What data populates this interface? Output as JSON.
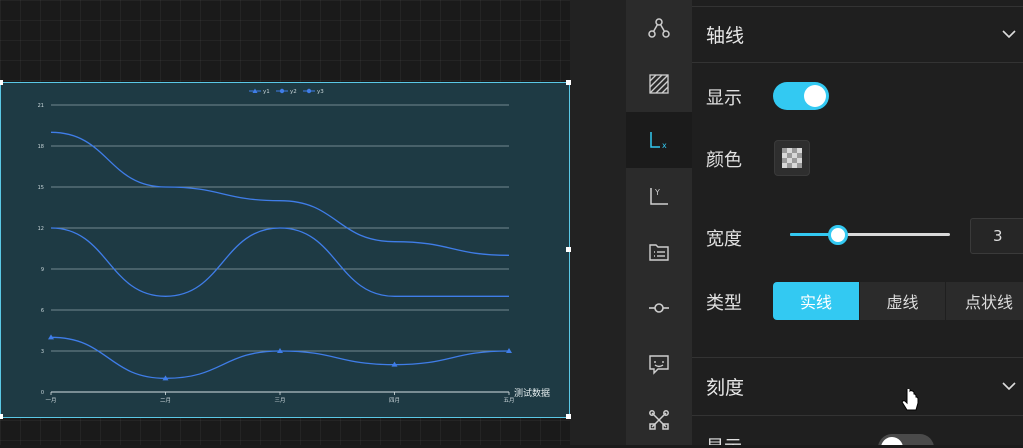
{
  "chart_data": {
    "type": "line",
    "categories": [
      "一月",
      "二月",
      "三月",
      "四月",
      "五月"
    ],
    "xlabel": "测试数据",
    "ylim": [
      0,
      21
    ],
    "yticks": [
      0,
      3,
      6,
      9,
      12,
      15,
      18,
      21
    ],
    "grid": true,
    "legend_position": "top-center",
    "series": [
      {
        "name": "y1",
        "values": [
          4,
          1,
          3,
          2,
          3
        ],
        "marker": "triangle"
      },
      {
        "name": "y2",
        "values": [
          12,
          7,
          12,
          7,
          7
        ],
        "marker": "circle"
      },
      {
        "name": "y3",
        "values": [
          19,
          15,
          14,
          11,
          10
        ],
        "marker": "circle"
      }
    ],
    "colors": {
      "line": "#3f7de8",
      "background": "#1e3a44",
      "grid": "#8fa3a8"
    }
  },
  "sidebar_icons": [
    "node-graph-icon",
    "hatched-area-icon",
    "x-axis-icon",
    "y-axis-icon",
    "legend-list-icon",
    "line-node-icon",
    "tooltip-icon",
    "tools-icon"
  ],
  "panel": {
    "axis_section": {
      "title": "轴线"
    },
    "show_label": "显示",
    "show_enabled": true,
    "color_label": "颜色",
    "width_label": "宽度",
    "width_value": "3",
    "width_slider_fraction": 0.3,
    "type_label": "类型",
    "line_types": [
      "实线",
      "虚线",
      "点状线"
    ],
    "line_type_selected": "实线",
    "tick_section": {
      "title": "刻度"
    },
    "tick_show_label": "显示",
    "tick_show_enabled": false,
    "accent_color": "#33c9f2"
  }
}
